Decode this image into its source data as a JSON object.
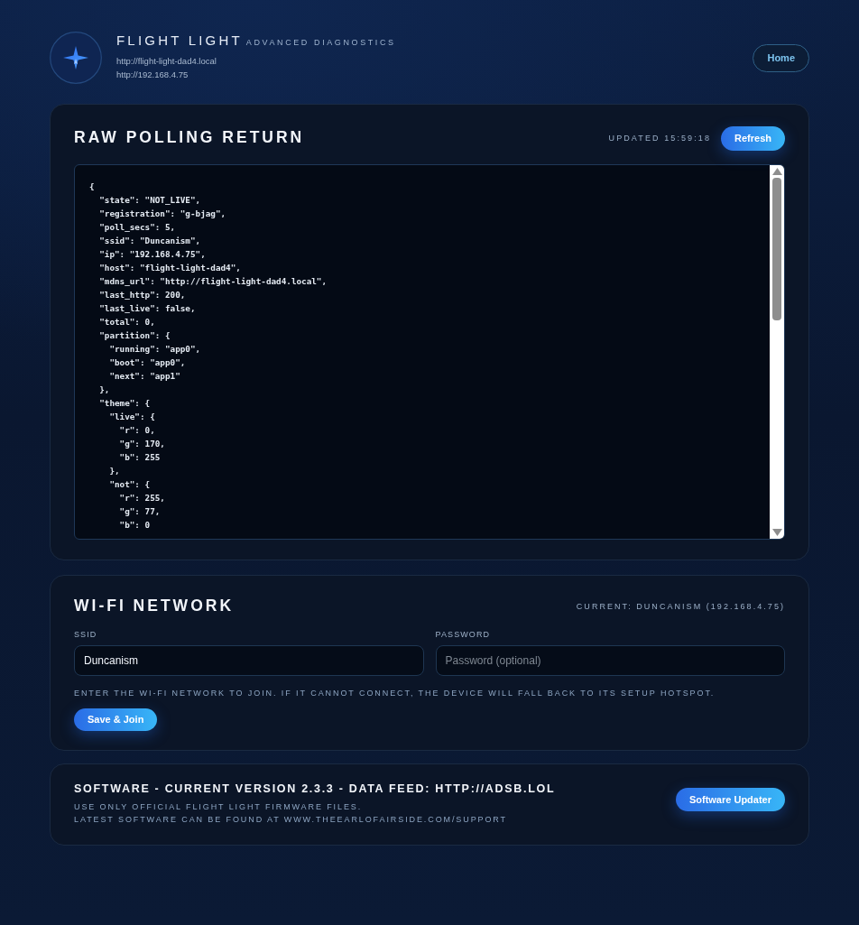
{
  "header": {
    "title": "FLIGHT LIGHT",
    "subtitle": "ADVANCED DIAGNOSTICS",
    "urls": [
      "http://flight-light-dad4.local",
      "http://192.168.4.75"
    ],
    "home_button": "Home"
  },
  "raw_panel": {
    "title": "RAW POLLING RETURN",
    "updated": "UPDATED 15:59:18",
    "refresh_button": "Refresh",
    "lines": [
      "{",
      "  \"state\": \"NOT_LIVE\",",
      "  \"registration\": \"g-bjag\",",
      "  \"poll_secs\": 5,",
      "  \"ssid\": \"Duncanism\",",
      "  \"ip\": \"192.168.4.75\",",
      "  \"host\": \"flight-light-dad4\",",
      "  \"mdns_url\": \"http://flight-light-dad4.local\",",
      "  \"last_http\": 200,",
      "  \"last_live\": false,",
      "  \"total\": 0,",
      "  \"partition\": {",
      "    \"running\": \"app0\",",
      "    \"boot\": \"app0\",",
      "    \"next\": \"app1\"",
      "  },",
      "  \"theme\": {",
      "    \"live\": {",
      "      \"r\": 0,",
      "      \"g\": 170,",
      "      \"b\": 255",
      "    },",
      "    \"not\": {",
      "      \"r\": 255,",
      "      \"g\": 77,",
      "      \"b\": 0"
    ]
  },
  "wifi_panel": {
    "title": "WI-FI NETWORK",
    "current": "CURRENT: DUNCANISM (192.168.4.75)",
    "fields": [
      {
        "label": "SSID",
        "value": "Duncanism"
      },
      {
        "label": "PASSWORD",
        "placeholder": "Password (optional)"
      }
    ],
    "help": "ENTER THE WI-FI NETWORK TO JOIN. IF IT CANNOT CONNECT, THE DEVICE WILL FALL BACK TO ITS SETUP HOTSPOT.",
    "button": "Save & Join"
  },
  "software_panel": {
    "title": "SOFTWARE - CURRENT VERSION 2.3.3 - DATA FEED: HTTP://ADSB.LOL",
    "notes": [
      "USE ONLY OFFICIAL FLIGHT LIGHT FIRMWARE FILES.",
      "LATEST SOFTWARE CAN BE FOUND AT WWW.THEEARLOFAIRSIDE.COM/SUPPORT"
    ],
    "button": "Software Updater"
  }
}
